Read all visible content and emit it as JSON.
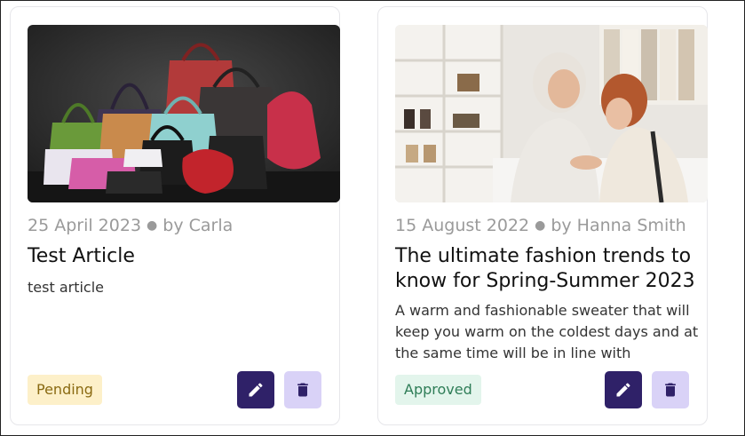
{
  "cards": [
    {
      "date": "25 April 2023",
      "author": "by Carla",
      "title": "Test Article",
      "description": "test article",
      "status": "Pending"
    },
    {
      "date": "15 August 2022",
      "author": "by Hanna Smith",
      "title": "The ultimate fashion trends to know for Spring-Summer 2023",
      "description": "A warm and fashionable sweater that will keep you warm on the coldest days and at the same time will be in line with",
      "status": "Approved"
    }
  ],
  "icons": {
    "edit": "pencil-icon",
    "delete": "trash-icon"
  },
  "colors": {
    "edit_button": "#2f2168",
    "delete_button": "#d9d2f7",
    "pending_bg": "#fdf0c9",
    "approved_bg": "#e3f5ec"
  }
}
